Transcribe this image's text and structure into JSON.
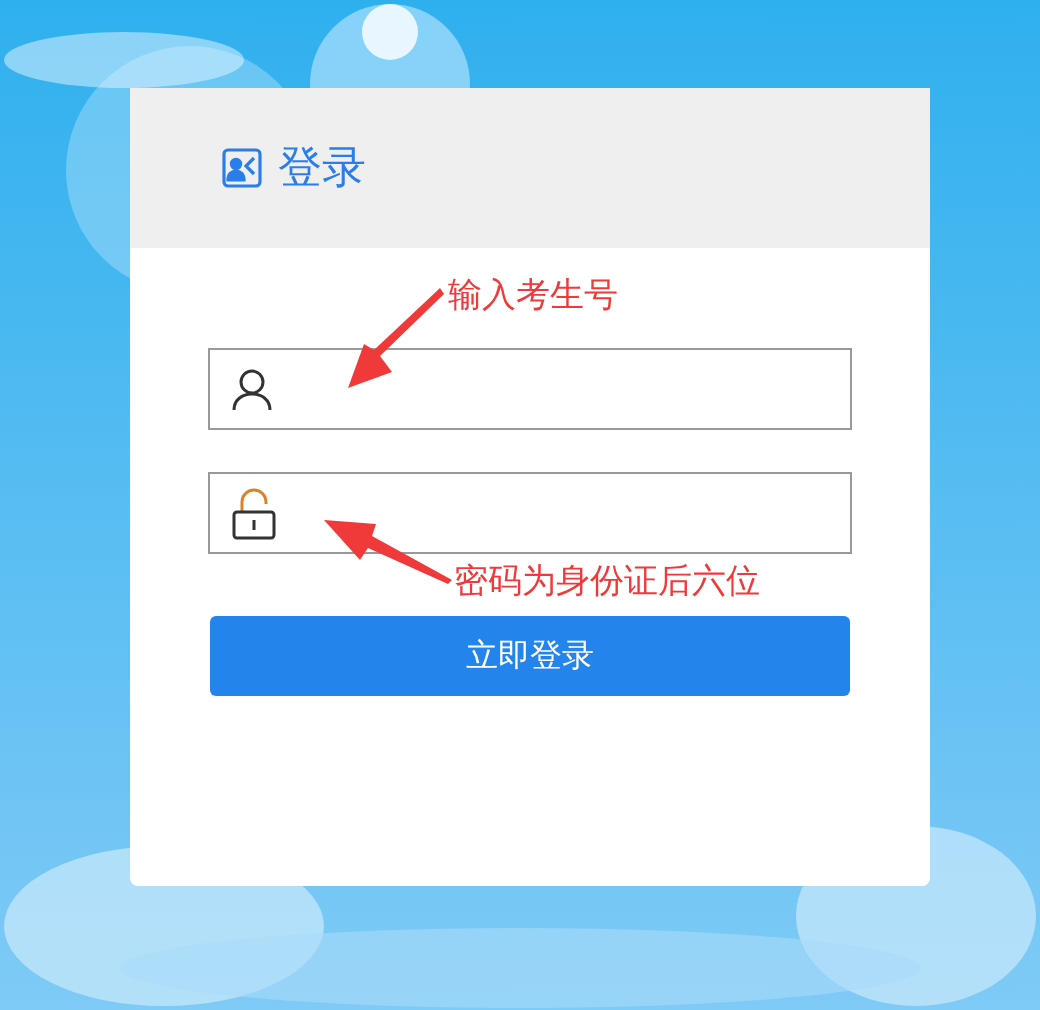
{
  "login_card": {
    "title": "登录",
    "fields": [
      {
        "kind": "user"
      },
      {
        "kind": "password"
      }
    ],
    "submit_button": "立即登录"
  },
  "annotations": [
    {
      "text": "输入考生号",
      "kind": "arrow-down-left"
    },
    {
      "text": "密码为身份证后六位",
      "kind": "arrow-up-left"
    }
  ]
}
